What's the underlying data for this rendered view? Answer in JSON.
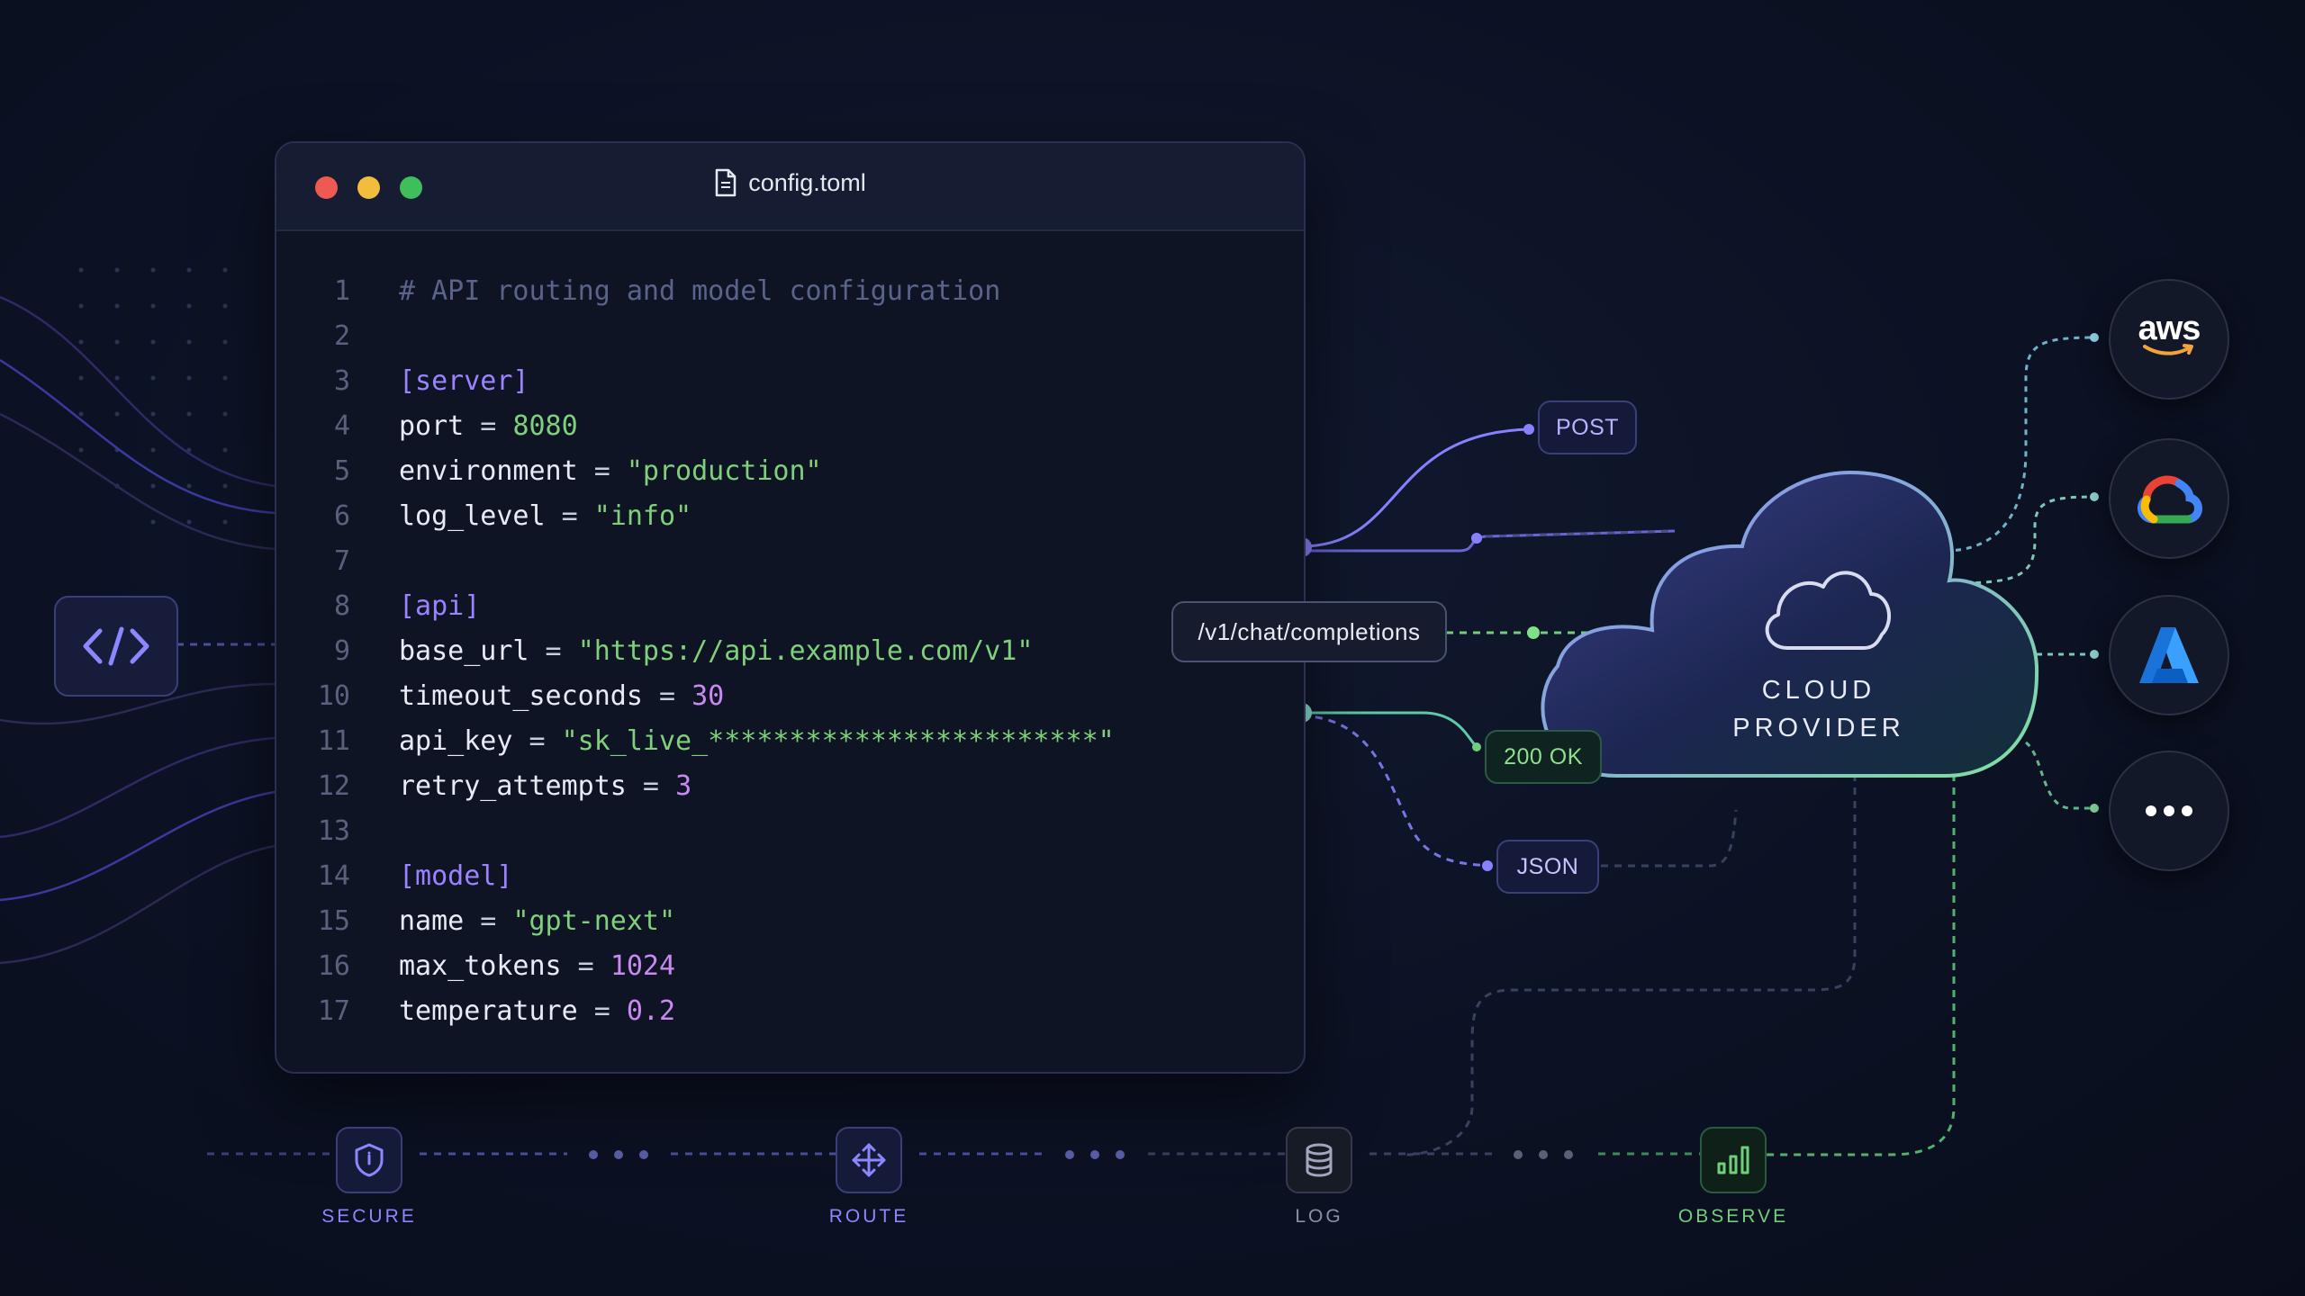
{
  "window": {
    "title": "config.toml",
    "lines": [
      {
        "n": "1",
        "comment": "# API routing and model configuration"
      },
      {
        "n": "2"
      },
      {
        "n": "3",
        "section": "[server]"
      },
      {
        "n": "4",
        "key": "port",
        "value": "8080",
        "vtype": "num-g"
      },
      {
        "n": "5",
        "key": "environment",
        "value": "\"production\"",
        "vtype": "str"
      },
      {
        "n": "6",
        "key": "log_level",
        "value": "\"info\"",
        "vtype": "str"
      },
      {
        "n": "7"
      },
      {
        "n": "8",
        "section": "[api]"
      },
      {
        "n": "9",
        "key": "base_url",
        "value": "\"https://api.example.com/v1\"",
        "vtype": "str"
      },
      {
        "n": "10",
        "key": "timeout_seconds",
        "value": "30",
        "vtype": "num-p"
      },
      {
        "n": "11",
        "key": "api_key",
        "value": "\"sk_live_************************\"",
        "vtype": "str"
      },
      {
        "n": "12",
        "key": "retry_attempts",
        "value": "3",
        "vtype": "num-p"
      },
      {
        "n": "13"
      },
      {
        "n": "14",
        "section": "[model]"
      },
      {
        "n": "15",
        "key": "name",
        "value": "\"gpt-next\"",
        "vtype": "str"
      },
      {
        "n": "16",
        "key": "max_tokens",
        "value": "1024",
        "vtype": "num-p"
      },
      {
        "n": "17",
        "key": "temperature",
        "value": "0.2",
        "vtype": "num-p"
      }
    ]
  },
  "pills": {
    "post": "POST",
    "endpoint": "/v1/chat/completions",
    "ok": "200 OK",
    "json": "JSON"
  },
  "cloud": {
    "line1": "CLOUD",
    "line2": "PROVIDER"
  },
  "providers": {
    "aws": "aws",
    "icons": [
      "aws-logo-icon",
      "google-cloud-logo-icon",
      "azure-logo-icon",
      "more-icon"
    ]
  },
  "pipeline": {
    "stages": [
      {
        "label": "SECURE",
        "icon": "shield-icon"
      },
      {
        "label": "ROUTE",
        "icon": "move-arrows-icon"
      },
      {
        "label": "LOG",
        "icon": "database-icon"
      },
      {
        "label": "OBSERVE",
        "icon": "bar-chart-icon"
      }
    ]
  },
  "colors": {
    "background": "#0c1224",
    "purple": "#8c86ff",
    "green": "#6fcf7a",
    "teal": "#8fe0d8"
  }
}
